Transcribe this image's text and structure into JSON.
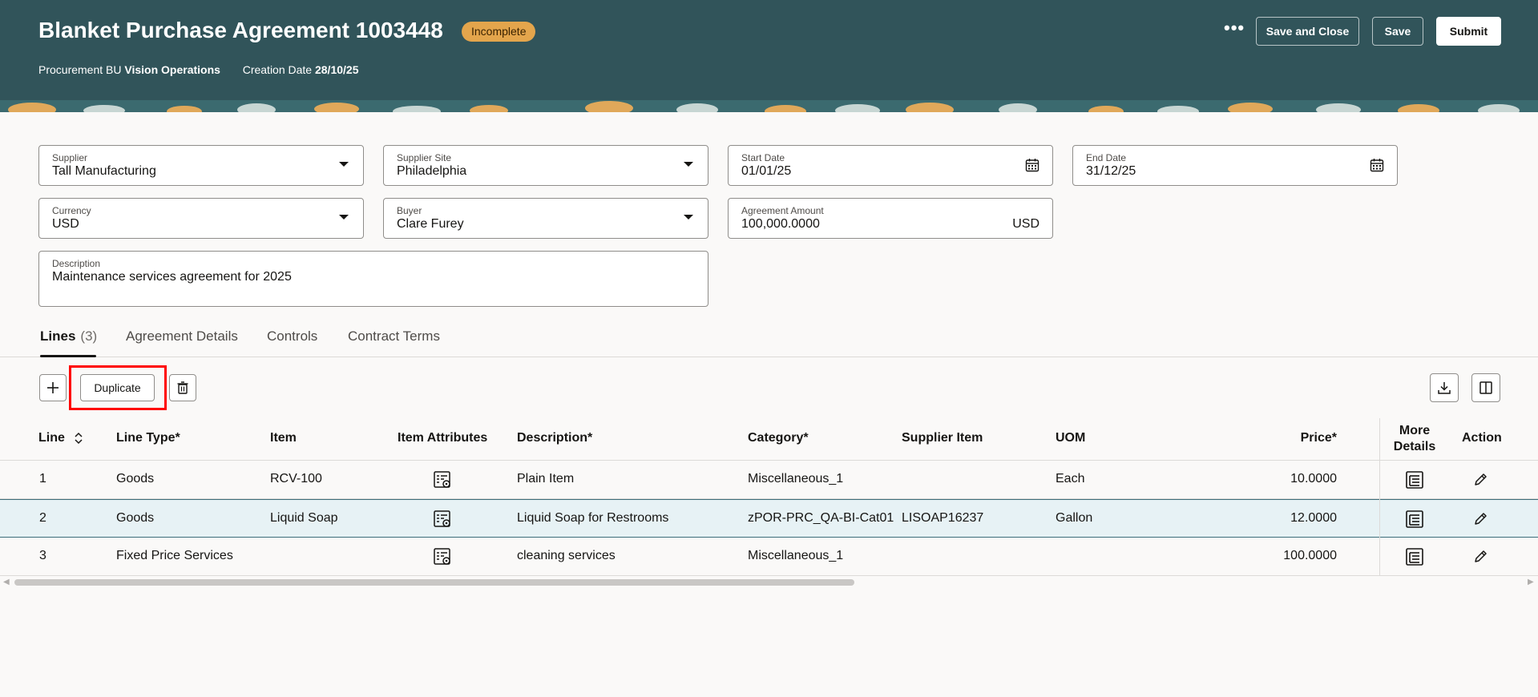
{
  "header": {
    "title": "Blanket Purchase Agreement 1003448",
    "status": "Incomplete",
    "bu_label": "Procurement BU",
    "bu_value": "Vision Operations",
    "creation_label": "Creation Date",
    "creation_value": "28/10/25",
    "more_icon": "more-horizontal-icon",
    "buttons": {
      "save_close": "Save and Close",
      "save": "Save",
      "submit": "Submit"
    }
  },
  "fields": {
    "supplier": {
      "label": "Supplier",
      "value": "Tall Manufacturing"
    },
    "supplier_site": {
      "label": "Supplier Site",
      "value": "Philadelphia"
    },
    "start_date": {
      "label": "Start Date",
      "value": "01/01/25"
    },
    "end_date": {
      "label": "End Date",
      "value": "31/12/25"
    },
    "currency": {
      "label": "Currency",
      "value": "USD"
    },
    "buyer": {
      "label": "Buyer",
      "value": "Clare Furey"
    },
    "agreement_amount": {
      "label": "Agreement Amount",
      "value": "100,000.0000",
      "suffix": "USD"
    },
    "description": {
      "label": "Description",
      "value": "Maintenance services agreement for 2025"
    }
  },
  "tabs": [
    {
      "label": "Lines",
      "count": "(3)"
    },
    {
      "label": "Agreement Details"
    },
    {
      "label": "Controls"
    },
    {
      "label": "Contract Terms"
    }
  ],
  "toolbar": {
    "duplicate_label": "Duplicate"
  },
  "table": {
    "headers": {
      "line": "Line",
      "line_type": "Line Type*",
      "item": "Item",
      "item_attributes": "Item Attributes",
      "description": "Description*",
      "category": "Category*",
      "supplier_item": "Supplier Item",
      "uom": "UOM",
      "price": "Price*",
      "more_details_1": "More",
      "more_details_2": "Details",
      "action": "Action"
    },
    "rows": [
      {
        "line": "1",
        "line_type": "Goods",
        "item": "RCV-100",
        "description": "Plain Item",
        "category": "Miscellaneous_1",
        "supplier_item": "",
        "uom": "Each",
        "price": "10.0000"
      },
      {
        "line": "2",
        "line_type": "Goods",
        "item": "Liquid Soap",
        "description": "Liquid Soap for Restrooms",
        "category": "zPOR-PRC_QA-BI-Cat01",
        "supplier_item": "LISOAP16237",
        "uom": "Gallon",
        "price": "12.0000"
      },
      {
        "line": "3",
        "line_type": "Fixed Price Services",
        "item": "",
        "description": "cleaning services",
        "category": "Miscellaneous_1",
        "supplier_item": "",
        "uom": "",
        "price": "100.0000"
      }
    ]
  },
  "colors": {
    "header_bg": "#31545a",
    "badge_bg": "#e3a54c",
    "selected_row": "#e7f2f5",
    "highlight": "#ff0000"
  }
}
